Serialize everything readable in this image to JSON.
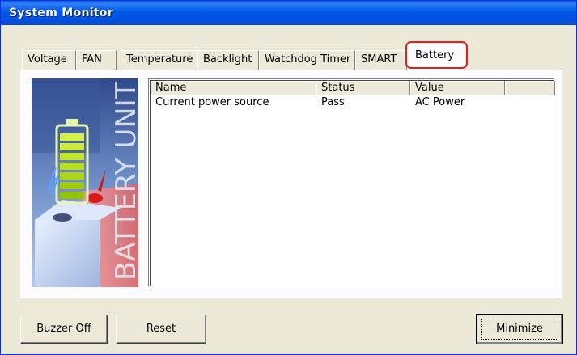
{
  "window": {
    "title": "System Monitor"
  },
  "tabs": [
    {
      "label": "Voltage"
    },
    {
      "label": "FAN"
    },
    {
      "label": "Temperature"
    },
    {
      "label": "Backlight"
    },
    {
      "label": "Watchdog Timer"
    },
    {
      "label": "SMART"
    },
    {
      "label": "Battery",
      "active": true
    }
  ],
  "panel": {
    "graphic_text": "BATTERY UNIT",
    "list": {
      "columns": [
        "Name",
        "Status",
        "Value"
      ],
      "rows": [
        {
          "name": "Current power source",
          "status": "Pass",
          "value": "AC Power"
        }
      ]
    }
  },
  "buttons": {
    "buzzer_off": "Buzzer Off",
    "reset": "Reset",
    "minimize": "Minimize"
  },
  "colors": {
    "title_bar": "#0054e3",
    "highlight": "#e0211d",
    "window_bg": "#ece9d8"
  }
}
